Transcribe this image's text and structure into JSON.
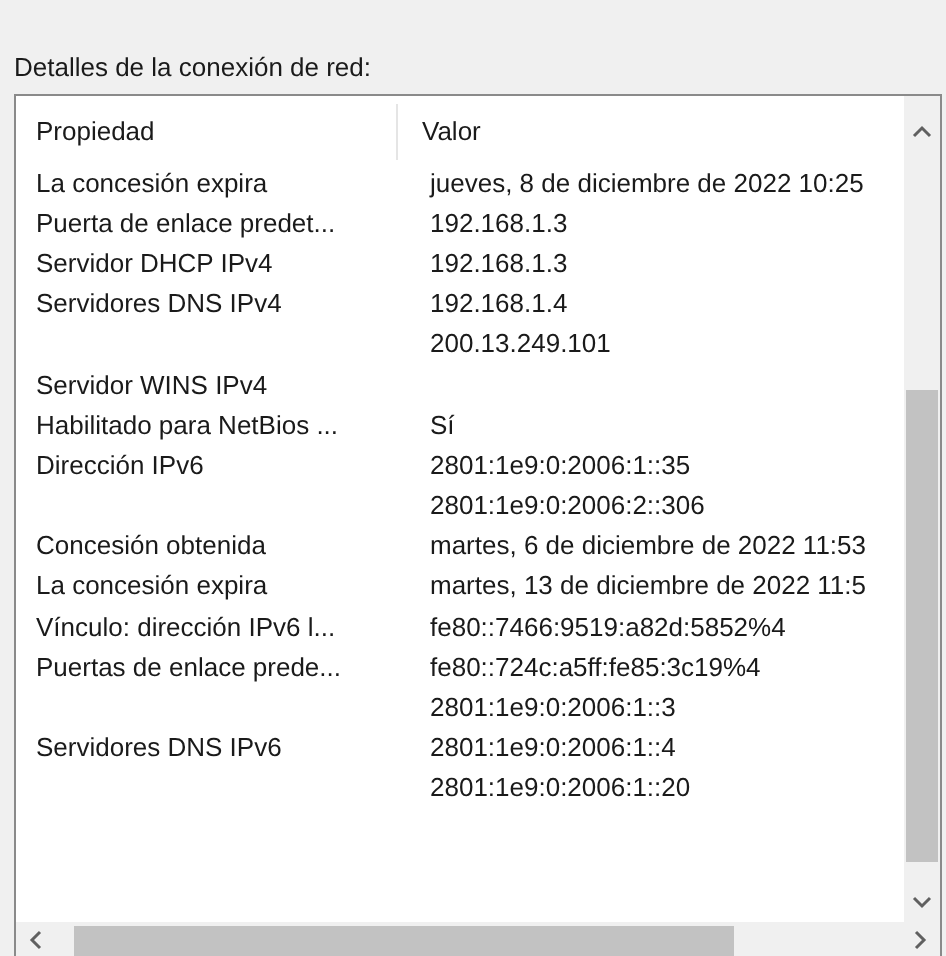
{
  "section_label": "Detalles de la conexión de red:",
  "table": {
    "columns": [
      "Propiedad",
      "Valor"
    ],
    "rows": [
      {
        "property": "La concesión expira",
        "value": "jueves, 8 de diciembre de 2022 10:25"
      },
      {
        "property": "Puerta de enlace predet...",
        "value": "192.168.1.3"
      },
      {
        "property": "Servidor DHCP IPv4",
        "value": "192.168.1.3"
      },
      {
        "property": "Servidores DNS IPv4",
        "value": "192.168.1.4"
      },
      {
        "value": "200.13.249.101"
      },
      {
        "property": "Servidor WINS IPv4"
      },
      {
        "property": "Habilitado para NetBios ...",
        "value": "Sí"
      },
      {
        "property": "Dirección IPv6",
        "value": "2801:1e9:0:2006:1::35"
      },
      {
        "value": "2801:1e9:0:2006:2::306"
      },
      {
        "property": "Concesión obtenida",
        "value": "martes, 6 de diciembre de 2022 11:53"
      },
      {
        "property": "La concesión expira",
        "value": "martes, 13 de diciembre de 2022 11:5"
      },
      {
        "property": "Vínculo: dirección IPv6 l...",
        "value": "fe80::7466:9519:a82d:5852%4"
      },
      {
        "property": "Puertas de enlace prede...",
        "value": "fe80::724c:a5ff:fe85:3c19%4"
      },
      {
        "value": "2801:1e9:0:2006:1::3"
      },
      {
        "property": "Servidores DNS IPv6",
        "value": "2801:1e9:0:2006:1::4"
      },
      {
        "value": "2801:1e9:0:2006:1::20"
      }
    ]
  }
}
